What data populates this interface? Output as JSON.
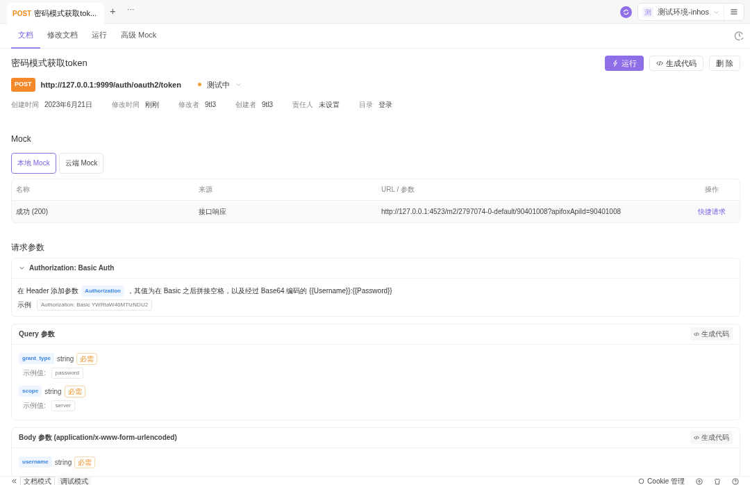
{
  "tab_bar": {
    "tabs": [
      {
        "method": "POST",
        "title": "密码模式获取tok...",
        "selected": true
      }
    ],
    "new_tab": "+",
    "more": "···",
    "env": {
      "badge": "测",
      "name": "测试环境-inhos"
    }
  },
  "doc_tabs": [
    {
      "label": "文档",
      "selected": true
    },
    {
      "label": "修改文档",
      "selected": false
    },
    {
      "label": "运行",
      "selected": false
    },
    {
      "label": "高级 Mock",
      "selected": false
    }
  ],
  "api": {
    "title": "密码模式获取token",
    "buttons": [
      {
        "label": "运行",
        "kind": "primary"
      },
      {
        "label": "生成代码",
        "kind": "code"
      },
      {
        "label": "删 除",
        "kind": "plain"
      }
    ],
    "method": "POST",
    "url": "http://127.0.0.1:9999/auth/oauth2/token",
    "status": "测试中",
    "meta": [
      {
        "label": "创建时间",
        "value": "2023年6月21日"
      },
      {
        "label": "修改时间",
        "value": "刚刚"
      },
      {
        "label": "修改者",
        "value": "9tl3"
      },
      {
        "label": "创建者",
        "value": "9tl3"
      },
      {
        "label": "责任人",
        "value": "未设置"
      },
      {
        "label": "目录",
        "value": "登录"
      }
    ]
  },
  "mock": {
    "title": "Mock",
    "toggles": [
      {
        "label": "本地 Mock",
        "selected": true
      },
      {
        "label": "云端 Mock",
        "selected": false
      }
    ],
    "columns": [
      "名称",
      "来源",
      "URL / 参数",
      "操作"
    ],
    "rows": [
      {
        "name": "成功 (200)",
        "source": "接口响应",
        "url": "http://127.0.0.1:4523/m2/2797074-0-default/90401008?apifoxApiId=90401008",
        "action": "快捷请求"
      }
    ]
  },
  "request_params": {
    "title": "请求参数",
    "auth": {
      "title": "Authorization: Basic Auth",
      "expanded": true,
      "text_before": "在 Header 添加参数",
      "code": "Authorization",
      "text_after": "，其值为在 Basic 之后拼接空格，以及经过 Base64 编码的 {{Username}}:{{Password}}",
      "example_label": "示例",
      "example": "Authorization: Basic YWRtaW46MTIzNDU2"
    },
    "sections": [
      {
        "title": "Query 参数",
        "action": "生成代码",
        "params": [
          {
            "name": "grant_type",
            "type": "string",
            "required": "必需",
            "example_label": "示例值:",
            "example": "password"
          },
          {
            "name": "scope",
            "type": "string",
            "required": "必需",
            "example_label": "示例值:",
            "example": "server"
          }
        ]
      },
      {
        "title": "Body 参数 (application/x-www-form-urlencoded)",
        "action": "生成代码",
        "params": [
          {
            "name": "username",
            "type": "string",
            "required": "必需"
          }
        ]
      }
    ]
  },
  "bottom_bar": {
    "modes": [
      {
        "label": "文档模式",
        "selected": true
      },
      {
        "label": "调试模式",
        "selected": false
      }
    ],
    "cookie": "Cookie 管理"
  }
}
